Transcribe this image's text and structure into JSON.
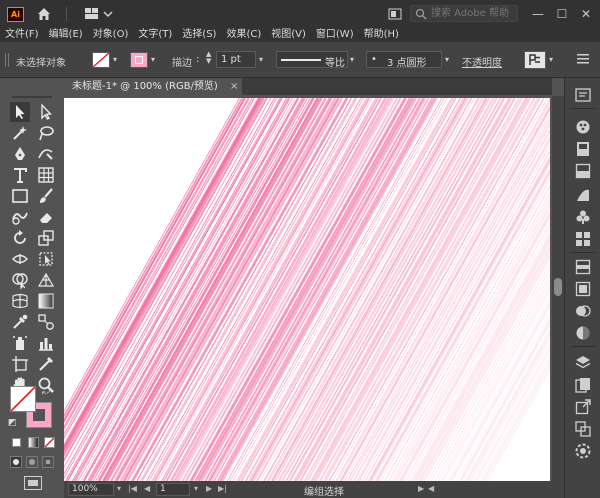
{
  "app": {
    "logo_text": "Ai"
  },
  "search": {
    "placeholder": "搜索 Adobe 帮助"
  },
  "window_controls": {
    "minimize": "—",
    "maximize": "☐",
    "close": "✕"
  },
  "menu": [
    "文件(F)",
    "编辑(E)",
    "对象(O)",
    "文字(T)",
    "选择(S)",
    "效果(C)",
    "视图(V)",
    "窗口(W)",
    "帮助(H)"
  ],
  "control_bar": {
    "selection_label": "未选择对象",
    "stroke_label": "描边",
    "stroke_weight": "1 pt",
    "stroke_profile": "等比",
    "brush_dot": "•",
    "brush": "3 点圆形",
    "opacity_label": "不透明度"
  },
  "document": {
    "tab_title": "未标题-1* @ 100% (RGB/预览)",
    "close": "×"
  },
  "status_bar": {
    "zoom": "100%",
    "page": "1",
    "status": "编组选择"
  },
  "colors": {
    "stripe_pink": "#f06a9e",
    "fill_swatch": "#ffffff",
    "stroke_swatch": "#f7a8c8",
    "app_bg": "#535353",
    "chrome_dark": "#323232",
    "logo_orange": "#ff9a00"
  },
  "icons": {
    "home": "home-icon",
    "search": "search-icon",
    "arrange_documents": "arrange-documents-icon"
  }
}
